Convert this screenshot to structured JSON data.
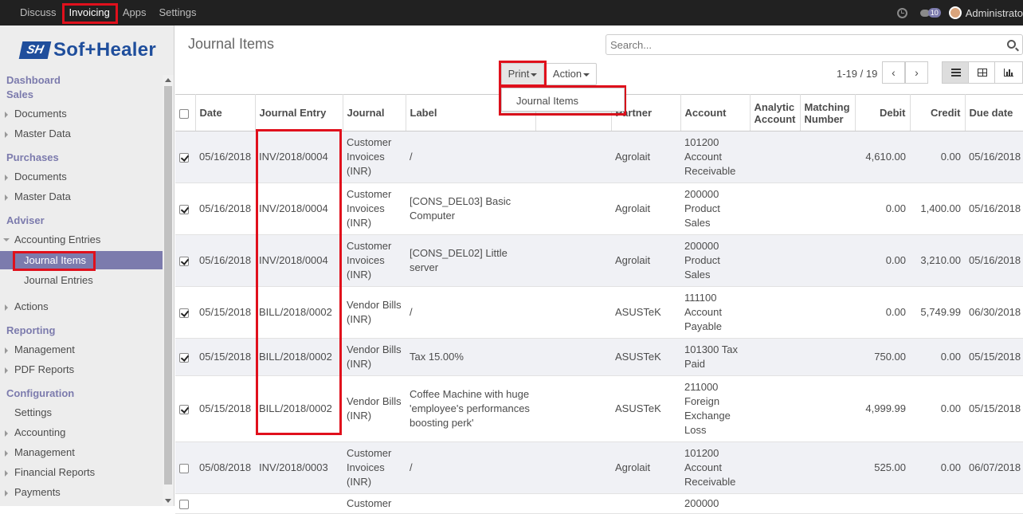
{
  "topnav": {
    "items": [
      "Discuss",
      "Invoicing",
      "Apps",
      "Settings"
    ],
    "active": "Invoicing"
  },
  "topright": {
    "chat_count": "10",
    "user": "Administrato"
  },
  "logo": {
    "mark": "SH",
    "word": "Sof+Healer"
  },
  "sidebar": {
    "dashboard": "Dashboard",
    "sales": "Sales",
    "sales_documents": "Documents",
    "sales_master": "Master Data",
    "purchases": "Purchases",
    "purchases_documents": "Documents",
    "purchases_master": "Master Data",
    "adviser": "Adviser",
    "accounting_entries": "Accounting Entries",
    "journal_items": "Journal Items",
    "journal_entries": "Journal Entries",
    "actions": "Actions",
    "reporting": "Reporting",
    "management": "Management",
    "pdf_reports": "PDF Reports",
    "configuration": "Configuration",
    "settings": "Settings",
    "accounting": "Accounting",
    "config_management": "Management",
    "financial_reports": "Financial Reports",
    "payments": "Payments"
  },
  "main": {
    "title": "Journal Items",
    "search_placeholder": "Search...",
    "print_label": "Print",
    "action_label": "Action",
    "dropdown_item": "Journal Items",
    "pager": "1-19 / 19",
    "prev": "‹",
    "next": "›"
  },
  "columns": [
    "Date",
    "Journal Entry",
    "Journal",
    "Label",
    "",
    "Partner",
    "Account",
    "Analytic Account",
    "Matching Number",
    "Debit",
    "Credit",
    "Due date"
  ],
  "rows": [
    {
      "checked": true,
      "date": "05/16/2018",
      "entry": "INV/2018/0004",
      "journal": "Customer Invoices (INR)",
      "label": "/",
      "partner": "Agrolait",
      "account": "101200 Account Receivable",
      "debit": "4,610.00",
      "credit": "0.00",
      "due": "05/16/2018"
    },
    {
      "checked": true,
      "date": "05/16/2018",
      "entry": "INV/2018/0004",
      "journal": "Customer Invoices (INR)",
      "label": "[CONS_DEL03] Basic Computer",
      "partner": "Agrolait",
      "account": "200000 Product Sales",
      "debit": "0.00",
      "credit": "1,400.00",
      "due": "05/16/2018"
    },
    {
      "checked": true,
      "date": "05/16/2018",
      "entry": "INV/2018/0004",
      "journal": "Customer Invoices (INR)",
      "label": "[CONS_DEL02] Little server",
      "partner": "Agrolait",
      "account": "200000 Product Sales",
      "debit": "0.00",
      "credit": "3,210.00",
      "due": "05/16/2018"
    },
    {
      "checked": true,
      "date": "05/15/2018",
      "entry": "BILL/2018/0002",
      "journal": "Vendor Bills (INR)",
      "label": "/",
      "partner": "ASUSTeK",
      "account": "111100 Account Payable",
      "debit": "0.00",
      "credit": "5,749.99",
      "due": "06/30/2018"
    },
    {
      "checked": true,
      "date": "05/15/2018",
      "entry": "BILL/2018/0002",
      "journal": "Vendor Bills (INR)",
      "label": "Tax 15.00%",
      "partner": "ASUSTeK",
      "account": "101300 Tax Paid",
      "debit": "750.00",
      "credit": "0.00",
      "due": "05/15/2018"
    },
    {
      "checked": true,
      "date": "05/15/2018",
      "entry": "BILL/2018/0002",
      "journal": "Vendor Bills (INR)",
      "label": "Coffee Machine with huge 'employee's performances boosting perk'",
      "partner": "ASUSTeK",
      "account": "211000 Foreign Exchange Loss",
      "debit": "4,999.99",
      "credit": "0.00",
      "due": "05/15/2018"
    },
    {
      "checked": false,
      "date": "05/08/2018",
      "entry": "INV/2018/0003",
      "journal": "Customer Invoices (INR)",
      "label": "/",
      "partner": "Agrolait",
      "account": "101200 Account Receivable",
      "debit": "525.00",
      "credit": "0.00",
      "due": "06/07/2018"
    },
    {
      "checked": false,
      "date": "",
      "entry": "",
      "journal": "Customer",
      "label": "",
      "partner": "",
      "account": "200000",
      "debit": "",
      "credit": "",
      "due": ""
    }
  ],
  "colors": {
    "topbar": "#212121",
    "accent": "#7c7bad",
    "highlight": "#e0101c",
    "sidebar": "#ededed"
  }
}
